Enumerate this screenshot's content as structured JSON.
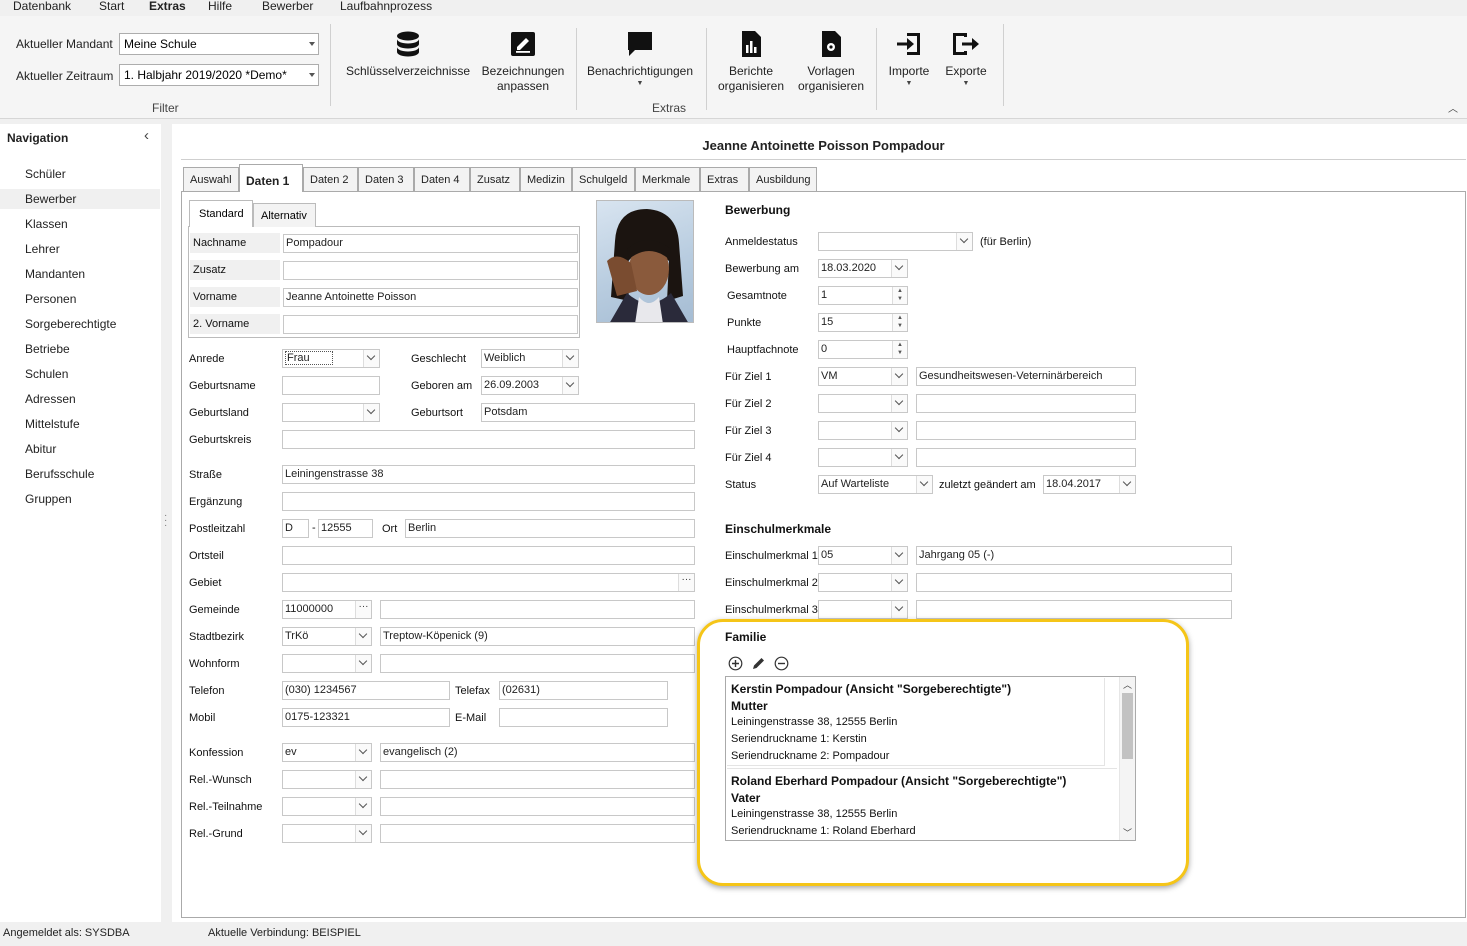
{
  "menu": {
    "items": [
      "Datenbank",
      "Start",
      "Extras",
      "Hilfe",
      "Bewerber",
      "Laufbahnprozess"
    ],
    "active": "Extras"
  },
  "ribbon": {
    "filter": {
      "mandant_label": "Aktueller Mandant",
      "mandant_value": "Meine Schule",
      "zeitraum_label": "Aktueller Zeitraum",
      "zeitraum_value": "1. Halbjahr 2019/2020 *Demo*",
      "group_label": "Filter"
    },
    "extras_group_label": "Extras",
    "buttons": {
      "schluessel": "Schlüsselverzeichnisse",
      "bez1": "Bezeichnungen",
      "bez2": "anpassen",
      "benach": "Benachrichtigungen",
      "berichte1": "Berichte",
      "berichte2": "organisieren",
      "vorlagen1": "Vorlagen",
      "vorlagen2": "organisieren",
      "importe": "Importe",
      "exporte": "Exporte"
    }
  },
  "nav": {
    "title": "Navigation",
    "items": [
      "Schüler",
      "Bewerber",
      "Klassen",
      "Lehrer",
      "Mandanten",
      "Personen",
      "Sorgeberechtigte",
      "Betriebe",
      "Schulen",
      "Adressen",
      "Mittelstufe",
      "Abitur",
      "Berufsschule",
      "Gruppen"
    ],
    "selected": "Bewerber"
  },
  "record_title": "Jeanne Antoinette Poisson Pompadour",
  "tabs": [
    "Auswahl",
    "Daten 1",
    "Daten 2",
    "Daten 3",
    "Daten 4",
    "Zusatz",
    "Medizin",
    "Schulgeld",
    "Merkmale",
    "Extras",
    "Ausbildung"
  ],
  "subtabs": [
    "Standard",
    "Alternativ"
  ],
  "name": {
    "nachname_l": "Nachname",
    "nachname": "Pompadour",
    "zusatz_l": "Zusatz",
    "zusatz": "",
    "vorname_l": "Vorname",
    "vorname": "Jeanne Antoinette Poisson",
    "vorname2_l": "2. Vorname",
    "vorname2": ""
  },
  "person": {
    "anrede_l": "Anrede",
    "anrede": "Frau",
    "geschlecht_l": "Geschlecht",
    "geschlecht": "Weiblich",
    "geburtsname_l": "Geburtsname",
    "geburtsname": "",
    "geboren_l": "Geboren am",
    "geboren": "26.09.2003",
    "geburtsland_l": "Geburtsland",
    "geburtsland": "",
    "geburtsort_l": "Geburtsort",
    "geburtsort": "Potsdam",
    "geburtskreis_l": "Geburtskreis",
    "geburtskreis": ""
  },
  "address": {
    "strasse_l": "Straße",
    "strasse": "Leiningenstrasse 38",
    "ergaenzung_l": "Ergänzung",
    "ergaenzung": "",
    "plz_l": "Postleitzahl",
    "land": "D",
    "dash": "-",
    "plz": "12555",
    "ort_l": "Ort",
    "ort": "Berlin",
    "ortsteil_l": "Ortsteil",
    "ortsteil": "",
    "gebiet_l": "Gebiet",
    "gebiet": "",
    "gemeinde_l": "Gemeinde",
    "gemeinde": "11000000",
    "gemeinde_text": "",
    "stadtbezirk_l": "Stadtbezirk",
    "stadtbezirk": "TrKö",
    "stadtbezirk_text": "Treptow-Köpenick (9)",
    "wohnform_l": "Wohnform",
    "wohnform": "",
    "wohnform_text": "",
    "telefon_l": "Telefon",
    "telefon": "(030) 1234567",
    "telefax_l": "Telefax",
    "telefax": "(02631)",
    "mobil_l": "Mobil",
    "mobil": "0175-123321",
    "email_l": "E-Mail",
    "email": ""
  },
  "religion": {
    "konfession_l": "Konfession",
    "konfession": "ev",
    "konfession_text": "evangelisch (2)",
    "wunsch_l": "Rel.-Wunsch",
    "wunsch": "",
    "wunsch_text": "",
    "teilnahme_l": "Rel.-Teilnahme",
    "teilnahme": "",
    "teilnahme_text": "",
    "grund_l": "Rel.-Grund",
    "grund": "",
    "grund_text": ""
  },
  "bewerbung": {
    "title": "Bewerbung",
    "anmeldestatus_l": "Anmeldestatus",
    "anmeldestatus": "",
    "anmeldestatus_hint": "(für Berlin)",
    "bewerbung_am_l": "Bewerbung am",
    "bewerbung_am": "18.03.2020",
    "gesamtnote_l": "Gesamtnote",
    "gesamtnote": "1",
    "punkte_l": "Punkte",
    "punkte": "15",
    "hauptfachnote_l": "Hauptfachnote",
    "hauptfachnote": "0",
    "ziel1_l": "Für Ziel 1",
    "ziel1": "VM",
    "ziel1_text": "Gesundheitswesen-Veterninärbereich",
    "ziel2_l": "Für Ziel 2",
    "ziel2": "",
    "ziel2_text": "",
    "ziel3_l": "Für Ziel 3",
    "ziel3": "",
    "ziel3_text": "",
    "ziel4_l": "Für Ziel 4",
    "ziel4": "",
    "ziel4_text": "",
    "status_l": "Status",
    "status": "Auf Warteliste",
    "geaendert_l": "zuletzt geändert am",
    "geaendert": "18.04.2017"
  },
  "einschul": {
    "title": "Einschulmerkmale",
    "m1_l": "Einschulmerkmal 1",
    "m1": "05",
    "m1_text": "Jahrgang 05 (-)",
    "m2_l": "Einschulmerkmal 2",
    "m2": "",
    "m2_text": "",
    "m3_l": "Einschulmerkmal 3",
    "m3": "",
    "m3_text": ""
  },
  "familie": {
    "title": "Familie",
    "entries": [
      {
        "name": "Kerstin Pompadour (Ansicht \"Sorgeberechtigte\")",
        "rolle": "Mutter",
        "adresse": "Leiningenstrasse 38, 12555 Berlin",
        "sd1": "Seriendruckname 1: Kerstin",
        "sd2": "Seriendruckname 2: Pompadour"
      },
      {
        "name": "Roland Eberhard Pompadour (Ansicht \"Sorgeberechtigte\")",
        "rolle": "Vater",
        "adresse": "Leiningenstrasse 38, 12555 Berlin",
        "sd1": "Seriendruckname 1: Roland Eberhard"
      }
    ]
  },
  "statusbar": {
    "user": "Angemeldet als: SYSDBA",
    "connection": "Aktuelle Verbindung: BEISPIEL"
  },
  "colors": {
    "highlight": "#f5c518",
    "nav_selected": "#f0f0f0"
  }
}
